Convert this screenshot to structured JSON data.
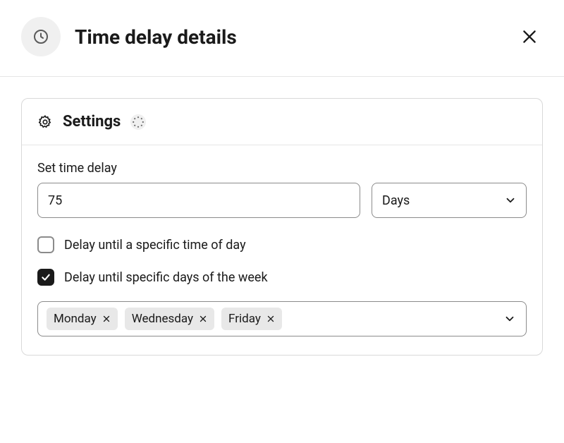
{
  "header": {
    "title": "Time delay details"
  },
  "settings": {
    "title": "Settings",
    "delay_label": "Set time delay",
    "delay_value": "75",
    "unit": {
      "selected": "Days"
    },
    "opt_time_of_day": {
      "checked": false,
      "label": "Delay until a specific time of day"
    },
    "opt_days_of_week": {
      "checked": true,
      "label": "Delay until specific days of the week"
    },
    "days": [
      "Monday",
      "Wednesday",
      "Friday"
    ]
  }
}
